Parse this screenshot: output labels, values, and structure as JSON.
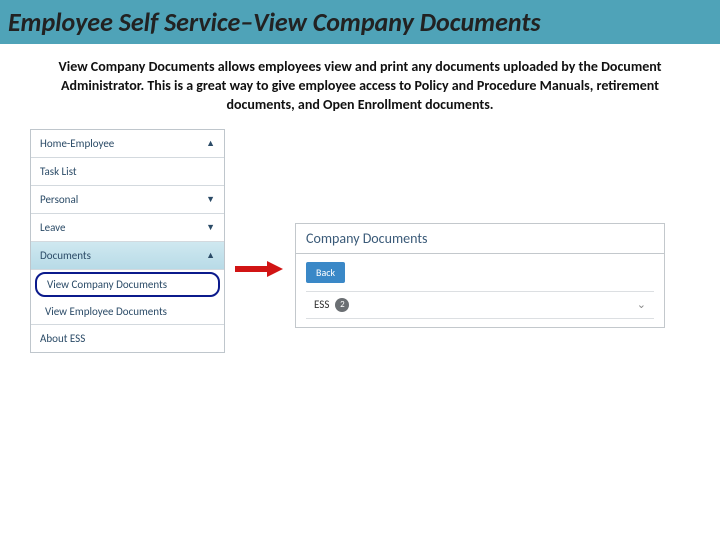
{
  "title": "Employee Self Service–View Company Documents",
  "description": "View Company Documents allows employees view and print any documents uploaded by the Document Administrator.  This is a great way to give employee access to Policy and Procedure Manuals, retirement documents, and Open Enrollment documents.",
  "sidebar": {
    "items": [
      {
        "label": "Home-Employee",
        "caret": "▲"
      },
      {
        "label": "Task List",
        "caret": ""
      },
      {
        "label": "Personal",
        "caret": "▼"
      },
      {
        "label": "Leave",
        "caret": "▼"
      },
      {
        "label": "Documents",
        "caret": "▲"
      },
      {
        "label": "About ESS",
        "caret": ""
      }
    ],
    "subitems": {
      "view_company": "View Company Documents",
      "view_employee": "View Employee Documents"
    }
  },
  "panel": {
    "header": "Company Documents",
    "back_label": "Back",
    "ess_label": "ESS",
    "ess_count": "2"
  }
}
